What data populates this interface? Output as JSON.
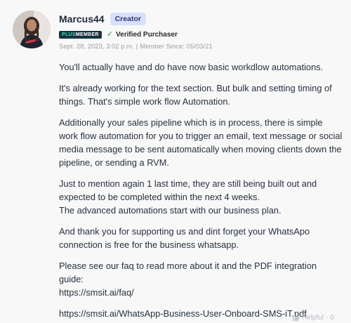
{
  "author": {
    "username": "Marcus44",
    "role_badge": "Creator",
    "plus_badge_prefix": "PLUS",
    "plus_badge_suffix": "MEMBER",
    "verified_label": "Verified Purchaser",
    "post_date": "Sept. 28, 2023, 3:02 p.m.",
    "member_since": "Member Since: 05/03/21",
    "meta_separator": "|"
  },
  "message": {
    "p1": "You'll actually have and do have now basic workdlow automations.",
    "p2": "It's already working for the text section. But bulk and setting timing of things. That's simple work flow Automation.",
    "p3": "Additionally your sales pipeline which is in process, there is simple work flow automation for you to trigger an email, text message or social media message to be sent automatically when moving clients down the pipeline, or sending a RVM.",
    "p4_line1": "Just to mention again 1 last time, they are still being built out and expected to be completed within the next 4 weeks.",
    "p4_line2": "The advanced automations start with our business plan.",
    "p5": "And thank you for supporting us and dint forget your WhatsApo connection is free for the business whatsapp.",
    "p6_text": "Please see our faq to read more about it and the PDF integration guide:",
    "p6_link": "https://smsit.ai/faq/",
    "p7_link": "https://smsit.ai/WhatsApp-Business-User-Onboard-SMS-iT.pdf"
  },
  "footer": {
    "helpful_label": "Helpful",
    "helpful_count": "0"
  },
  "colors": {
    "background": "#f8f8f8",
    "creator_badge_bg": "#d8e0fb",
    "plus_badge_bg": "#17323f",
    "verified_check": "#1aa05a"
  },
  "icons": {
    "verified": "check-icon",
    "helpful": "thumbs-up-icon"
  }
}
